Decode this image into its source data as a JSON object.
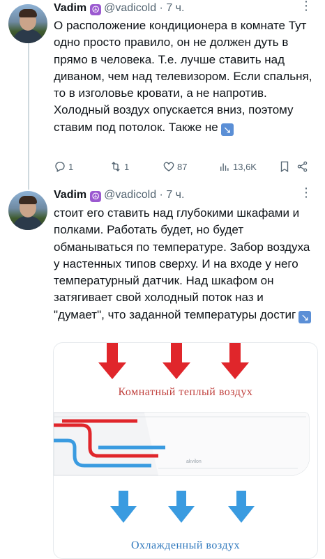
{
  "tweets": [
    {
      "author": "Vadim",
      "badge": "☮",
      "handle": "@vadicold",
      "separator": " · ",
      "time": "7 ч.",
      "text": "О расположение кондиционера в комнате Тут одно просто правило, он не должен дуть в прямо в человека. Т.е. лучше ставить над диваном, чем над телевизором. Если спальня, то в изголовье кровати, а не напротив. Холодный воздух опускается вниз, поэтому ставим под потолок. Также не",
      "emoji": "↘",
      "stats": {
        "replies": "1",
        "retweets": "1",
        "likes": "87",
        "views": "13,6K"
      }
    },
    {
      "author": "Vadim",
      "badge": "☮",
      "handle": "@vadicold",
      "separator": " · ",
      "time": "7 ч.",
      "text": "стоит его ставить над глубокими шкафами и полками. Работать будет, но будет обманываться по температуре. Забор воздуха у настенных типов сверху. И на входе у него температурный датчик. Над шкафом он затягивает свой холодный поток наз и \"думает\", что заданной температуры достиг",
      "emoji": "↘",
      "image": {
        "warm_caption": "Комнатный теплый воздух",
        "cold_caption": "Охлажденный воздух",
        "brand": "akvilon",
        "colors": {
          "warm": "#e0262b",
          "cold": "#3a9be0"
        }
      }
    }
  ],
  "icons": {
    "reply": "reply-icon",
    "retweet": "retweet-icon",
    "like": "heart-icon",
    "views": "views-icon",
    "bookmark": "bookmark-icon",
    "share": "share-icon",
    "more": "more-icon"
  }
}
